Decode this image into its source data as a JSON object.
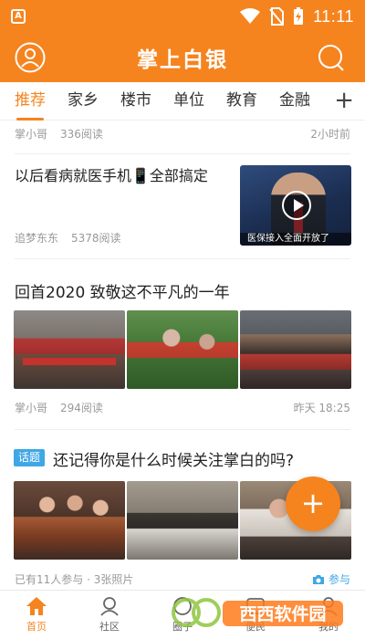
{
  "status_bar": {
    "time": "11:11"
  },
  "header": {
    "title": "掌上白银"
  },
  "tabs": [
    "推荐",
    "家乡",
    "楼市",
    "单位",
    "教育",
    "金融"
  ],
  "tab_add": "+",
  "feed": {
    "row0": {
      "author": "掌小哥",
      "reads": "336阅读",
      "time": "2小时前"
    },
    "article1": {
      "title": "以后看病就医手机📱全部搞定",
      "author": "追梦东东",
      "reads": "5378阅读",
      "video_caption": "医保接入全面开放了"
    },
    "article2": {
      "title": "回首2020 致敬这不平凡的一年",
      "author": "掌小哥",
      "reads": "294阅读",
      "time": "昨天 18:25"
    },
    "article3": {
      "badge": "话题",
      "title": "还记得你是什么时候关注掌白的吗?",
      "participants": "已有11人参与 · 3张照片",
      "join_label": "参与"
    }
  },
  "fab_label": "+",
  "bottom_nav": [
    {
      "label": "首页",
      "icon": "home-icon",
      "active": true
    },
    {
      "label": "社区",
      "icon": "community-icon",
      "active": false
    },
    {
      "label": "圈子",
      "icon": "circle-icon",
      "active": false
    },
    {
      "label": "便民",
      "icon": "service-icon",
      "active": false
    },
    {
      "label": "我的",
      "icon": "profile-icon",
      "active": false
    }
  ],
  "watermark": {
    "text": "西西软件园"
  },
  "colors": {
    "brand": "#f5841f",
    "topic_blue": "#3fa7e6"
  }
}
